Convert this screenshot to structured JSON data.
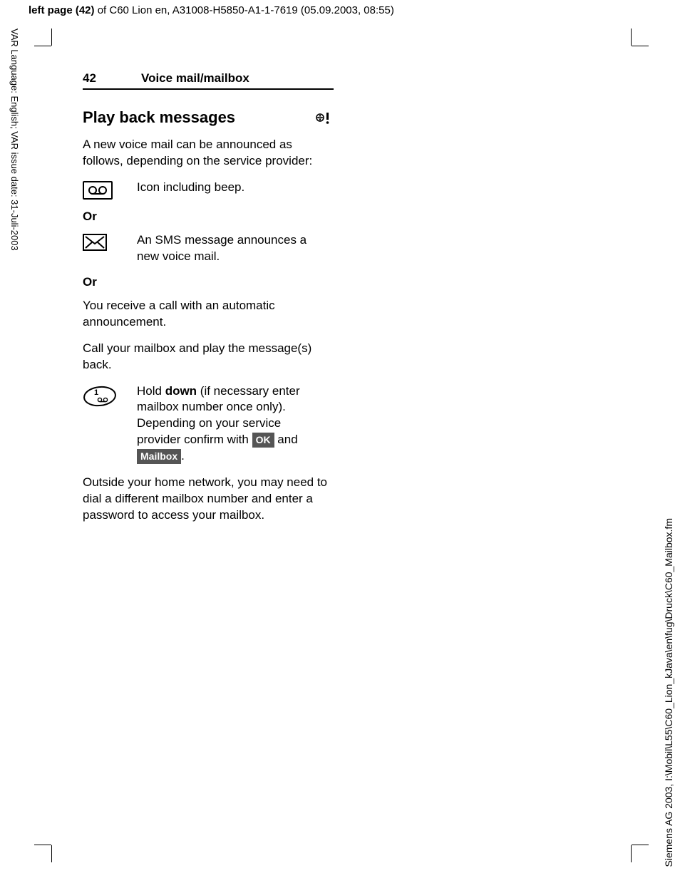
{
  "meta": {
    "header_bold": "left page (42)",
    "header_rest": " of C60 Lion en, A31008-H5850-A1-1-7619 (05.09.2003, 08:55)",
    "side_left": "VAR Language: English; VAR issue date: 31-Juli-2003",
    "side_right": "Siemens AG 2003, I:\\Mobil\\L55\\C60_Lion_kJava\\en\\fug\\Druck\\C60_Mailbox.fm"
  },
  "page": {
    "number": "42",
    "title": "Voice mail/mailbox",
    "heading": "Play back messages",
    "intro": "A new voice mail can be announced as follows, depending on the service provider:",
    "row1_text": "Icon including beep.",
    "or": "Or",
    "row2_text": "An SMS message announces a new voice mail.",
    "para3": "You receive a call with an automatic announcement.",
    "para4": "Call your mailbox and play the message(s) back.",
    "row3_pre": "Hold ",
    "row3_bold": "down",
    "row3_mid": " (if necessary enter mailbox number once only). Depending on your service provider confirm with ",
    "ok_label": "OK",
    "row3_and": " and ",
    "mailbox_label": "Mailbox",
    "row3_end": ".",
    "para5": "Outside your home network, you may need to dial a different mailbox number and enter a password to access your mailbox."
  }
}
